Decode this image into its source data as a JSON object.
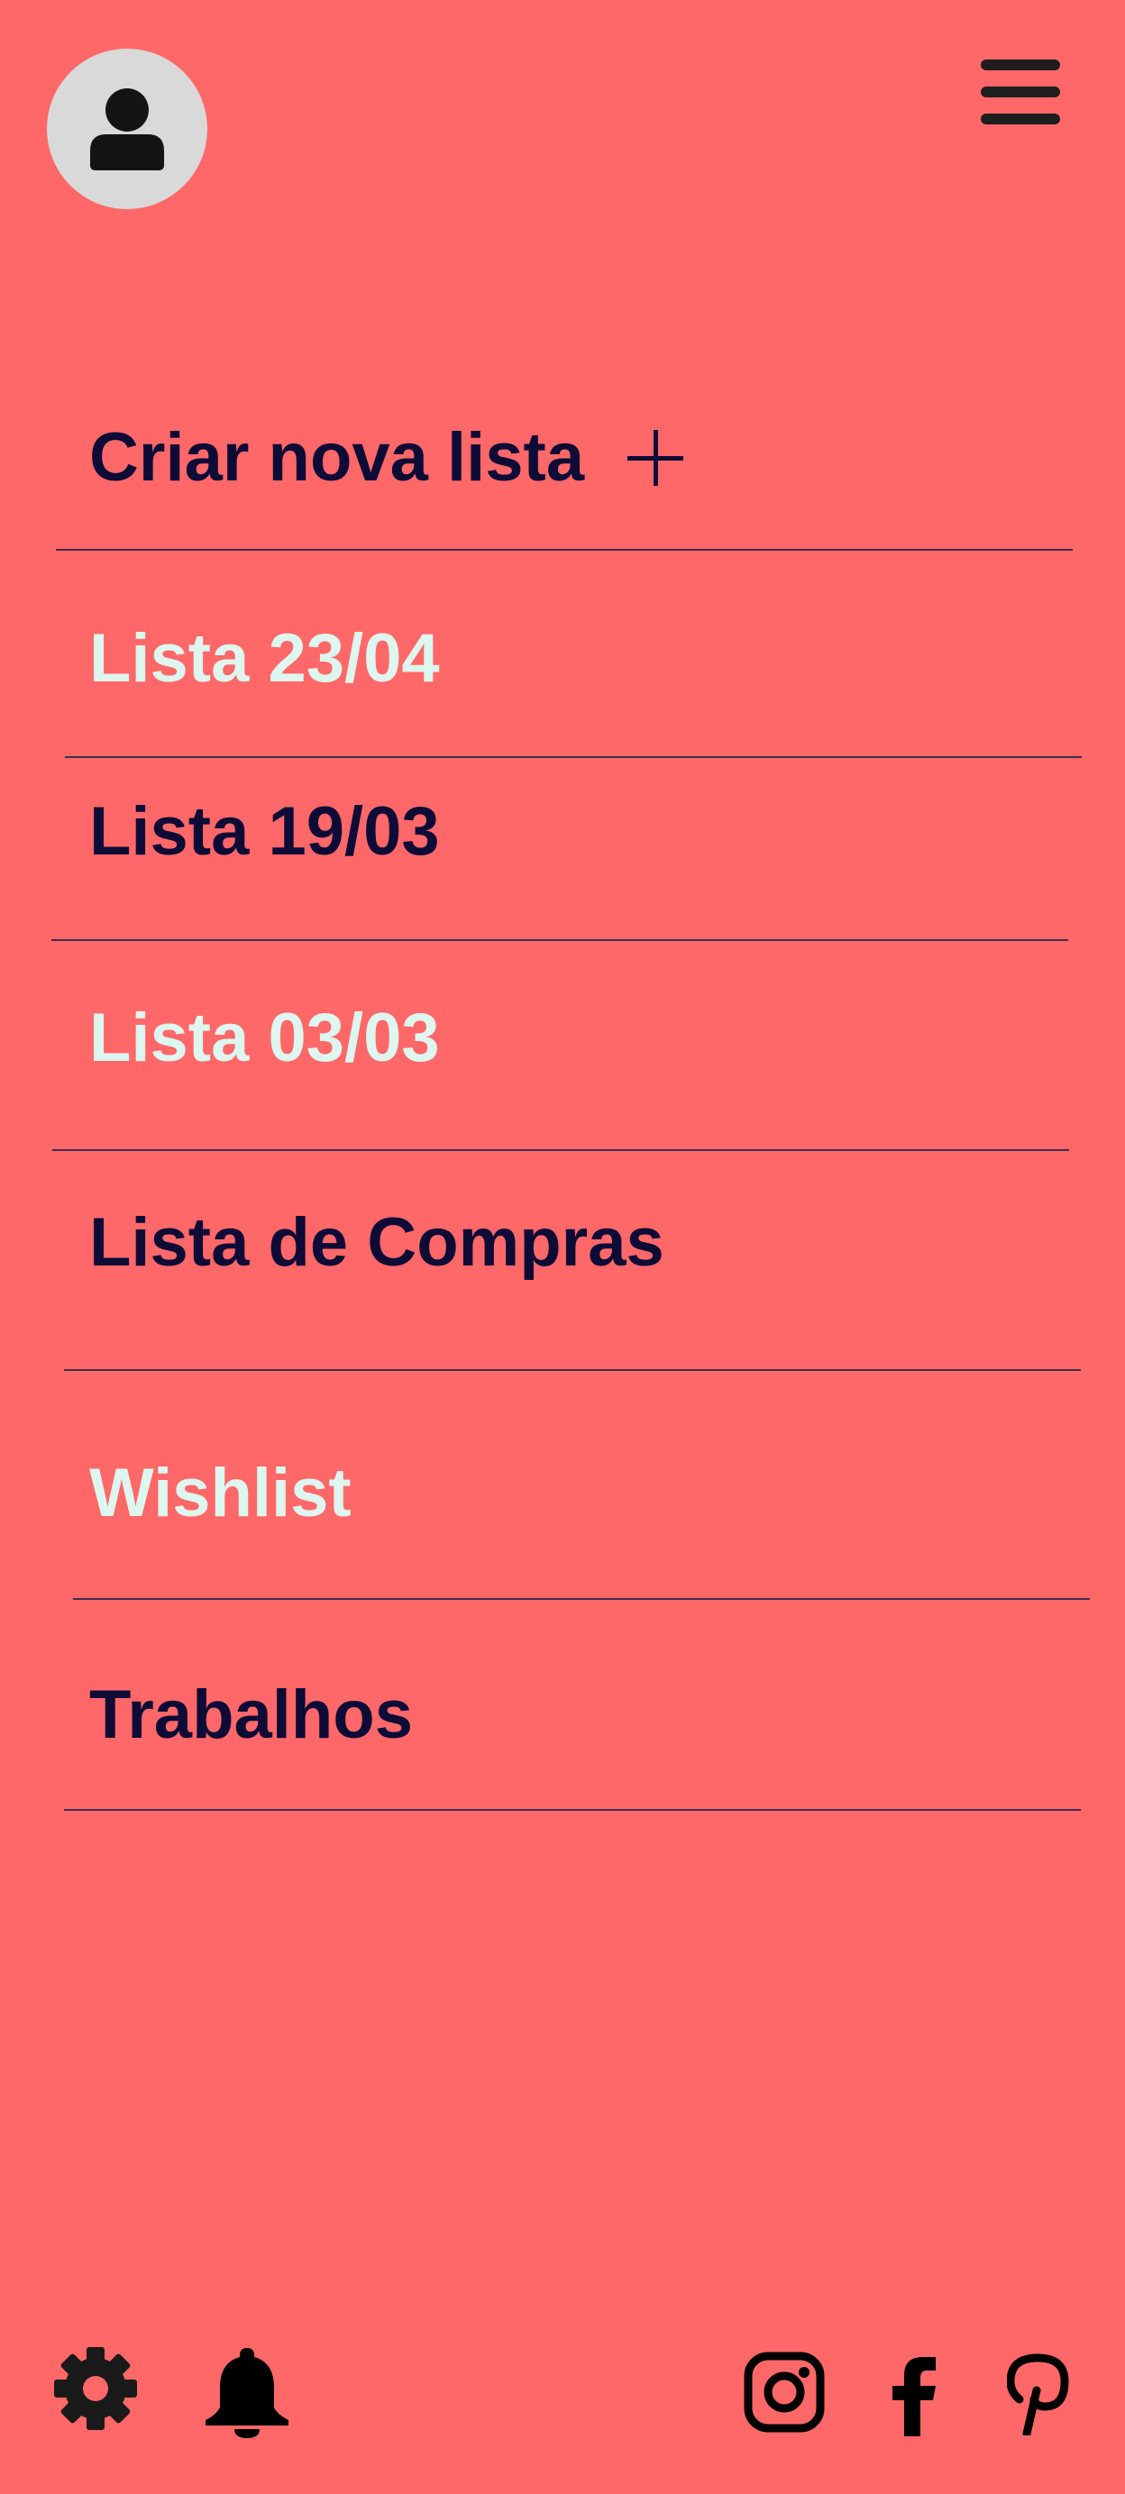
{
  "header": {
    "avatar_icon": "user-icon",
    "menu_icon": "hamburger-menu-icon"
  },
  "create": {
    "label": "Criar nova lista",
    "icon": "plus-icon"
  },
  "lists": [
    {
      "label": "Lista 23/04",
      "color": "#DDF6EF"
    },
    {
      "label": "Lista 19/03",
      "color": "#0E0B37"
    },
    {
      "label": "Lista 03/03",
      "color": "#DDF6EF"
    },
    {
      "label": "Lista de Compras",
      "color": "#0E0B37"
    },
    {
      "label": "Wishlist",
      "color": "#DDF6EF"
    },
    {
      "label": "Trabalhos",
      "color": "#0E0B37"
    }
  ],
  "footer": {
    "icons": [
      "gear-icon",
      "bell-icon",
      "instagram-icon",
      "facebook-icon",
      "pinterest-icon"
    ]
  },
  "colors": {
    "background": "#FF6868",
    "dark_text": "#0E0B37",
    "light_text": "#DDF6EF",
    "divider": "#3D2E4E",
    "avatar_bg": "#D9D9D9"
  }
}
